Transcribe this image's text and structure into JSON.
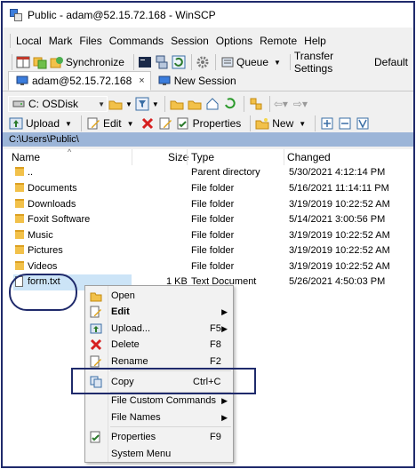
{
  "window": {
    "title": "Public - adam@52.15.72.168 - WinSCP"
  },
  "menu": [
    "Local",
    "Mark",
    "Files",
    "Commands",
    "Session",
    "Options",
    "Remote",
    "Help"
  ],
  "toolbar1": {
    "synchronize": "Synchronize",
    "queue": "Queue",
    "transfer_settings": "Transfer Settings",
    "transfer_value": "Default"
  },
  "tabs": [
    {
      "label": "adam@52.15.72.168",
      "close": "×"
    },
    {
      "label": "New Session"
    }
  ],
  "drive": {
    "label": "C: OSDisk"
  },
  "actions": {
    "upload": "Upload",
    "edit": "Edit",
    "properties": "Properties",
    "new": "New"
  },
  "path": "C:\\Users\\Public\\",
  "columns": {
    "name": "Name",
    "size": "Size",
    "type": "Type",
    "changed": "Changed"
  },
  "files": [
    {
      "name": "..",
      "size": "",
      "type": "Parent directory",
      "changed": "5/30/2021  4:12:14 PM"
    },
    {
      "name": "Documents",
      "size": "",
      "type": "File folder",
      "changed": "5/16/2021  11:14:11 PM"
    },
    {
      "name": "Downloads",
      "size": "",
      "type": "File folder",
      "changed": "3/19/2019  10:22:52 AM"
    },
    {
      "name": "Foxit Software",
      "size": "",
      "type": "File folder",
      "changed": "5/14/2021  3:00:56 PM"
    },
    {
      "name": "Music",
      "size": "",
      "type": "File folder",
      "changed": "3/19/2019  10:22:52 AM"
    },
    {
      "name": "Pictures",
      "size": "",
      "type": "File folder",
      "changed": "3/19/2019  10:22:52 AM"
    },
    {
      "name": "Videos",
      "size": "",
      "type": "File folder",
      "changed": "3/19/2019  10:22:52 AM"
    },
    {
      "name": "form.txt",
      "size": "1 KB",
      "type": "Text Document",
      "changed": "5/26/2021  4:50:03 PM"
    }
  ],
  "context_menu": {
    "open": "Open",
    "edit": "Edit",
    "upload": "Upload...",
    "upload_key": "F5",
    "delete": "Delete",
    "delete_key": "F8",
    "rename": "Rename",
    "rename_key": "F2",
    "copy": "Copy",
    "copy_key": "Ctrl+C",
    "file_custom_commands": "File Custom Commands",
    "file_names": "File Names",
    "properties": "Properties",
    "properties_key": "F9",
    "system_menu": "System Menu"
  }
}
